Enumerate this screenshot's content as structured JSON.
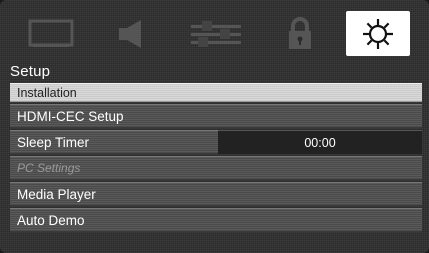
{
  "tabs": [
    {
      "icon": "picture-icon"
    },
    {
      "icon": "audio-icon"
    },
    {
      "icon": "equalizer-icon"
    },
    {
      "icon": "lock-icon"
    },
    {
      "icon": "gear-icon",
      "selected": true
    }
  ],
  "menu": {
    "title": "Setup",
    "items": [
      {
        "label": "Installation",
        "selected": true
      },
      {
        "label": "HDMI-CEC Setup"
      },
      {
        "label": "Sleep Timer",
        "value": "00:00"
      },
      {
        "label": "PC Settings",
        "disabled": true
      },
      {
        "label": "Media Player"
      },
      {
        "label": "Auto Demo"
      }
    ]
  }
}
